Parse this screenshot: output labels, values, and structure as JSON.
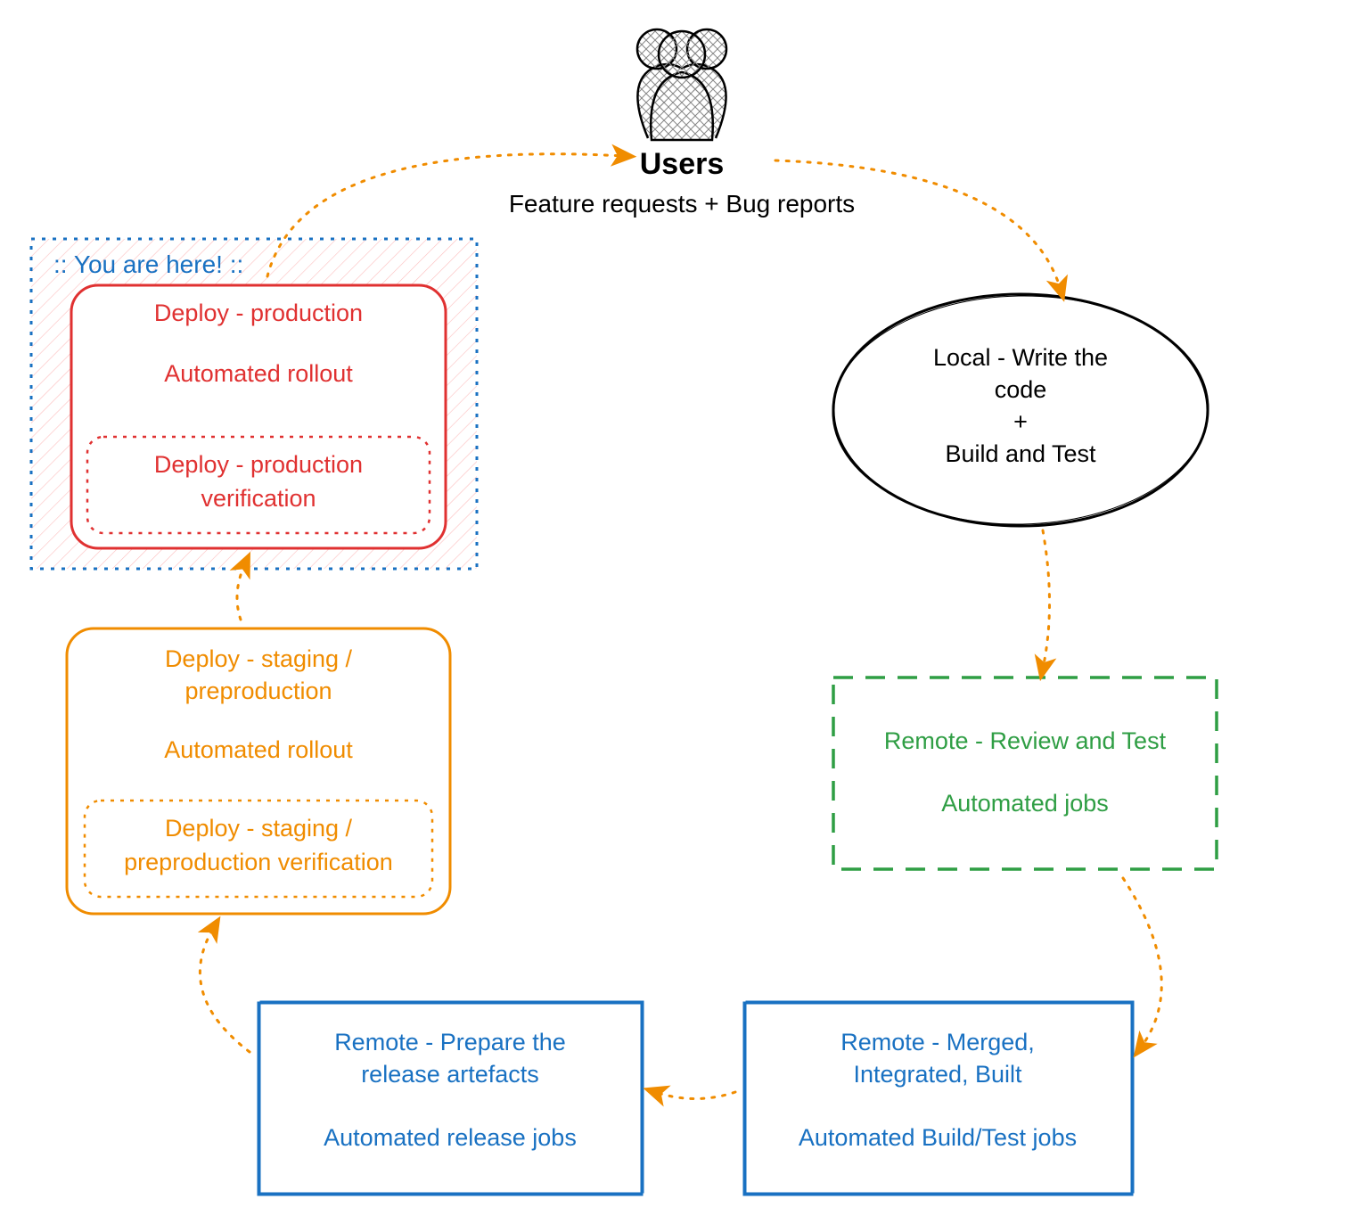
{
  "users": {
    "title": "Users",
    "subtitle": "Feature requests + Bug reports"
  },
  "callout": {
    "label": ":: You are here! ::"
  },
  "nodes": {
    "deploy_prod": {
      "title": "Deploy - production",
      "line2": "Automated rollout",
      "inner1": "Deploy - production",
      "inner2": "verification"
    },
    "deploy_staging": {
      "title1": "Deploy - staging /",
      "title2": "preproduction",
      "line2": "Automated rollout",
      "inner1": "Deploy - staging /",
      "inner2": "preproduction verification"
    },
    "local": {
      "line1": "Local - Write the",
      "line2": "code",
      "line3": "+",
      "line4": "Build and Test"
    },
    "review": {
      "line1": "Remote - Review and Test",
      "line2": "Automated jobs"
    },
    "merged": {
      "line1": "Remote - Merged,",
      "line2": "Integrated, Built",
      "line3": "Automated Build/Test jobs"
    },
    "release": {
      "line1": "Remote - Prepare the",
      "line2": "release artefacts",
      "line3": "Automated release jobs"
    }
  },
  "colors": {
    "black": "#000000",
    "red": "#e03131",
    "orange": "#f08c00",
    "green": "#2f9e44",
    "blue": "#1971c2",
    "redFill": "#ffe3e3"
  }
}
